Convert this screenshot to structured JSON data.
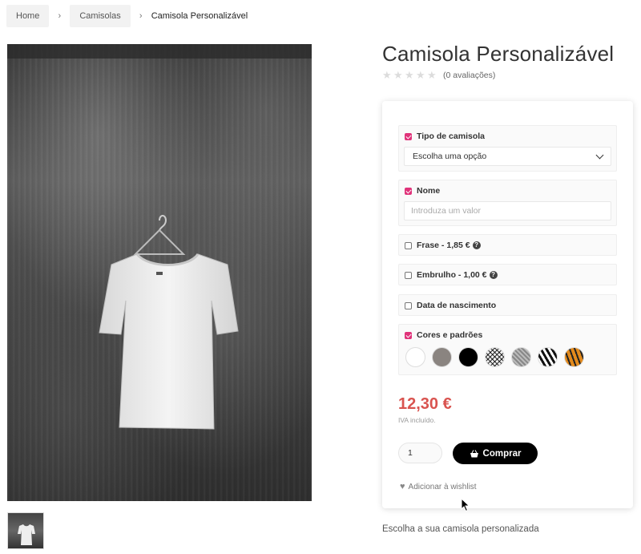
{
  "breadcrumb": {
    "home": "Home",
    "category": "Camisolas",
    "current": "Camisola Personalizável",
    "separator": "›"
  },
  "product": {
    "title": "Camisola Personalizável",
    "rating_stars": 0,
    "rating_count": "(0 avaliações)",
    "price": "12,30 €",
    "vat_note": "IVA incluído.",
    "quantity": "1",
    "buy_label": "Comprar",
    "wishlist_label": "Adicionar à wishlist",
    "description": "Escolha a sua camisola personalizada"
  },
  "options": {
    "tipo": {
      "label": "Tipo de camisola",
      "checked": true,
      "selected": "Escolha uma opção"
    },
    "nome": {
      "label": "Nome",
      "checked": true,
      "placeholder": "Introduza um valor"
    },
    "frase": {
      "label": "Frase - 1,85 €",
      "checked": false,
      "help": "?"
    },
    "embrulho": {
      "label": "Embrulho - 1,00 €",
      "checked": false,
      "help": "?"
    },
    "data": {
      "label": "Data de nascimento",
      "checked": false
    },
    "cores": {
      "label": "Cores e padrões",
      "checked": true,
      "swatches": [
        "white",
        "gray",
        "black",
        "crosshatch",
        "gray-pattern",
        "zebra",
        "tiger"
      ]
    }
  },
  "colors": {
    "accent_checkbox": "#e0337a",
    "price": "#d9534f",
    "button": "#000000"
  }
}
